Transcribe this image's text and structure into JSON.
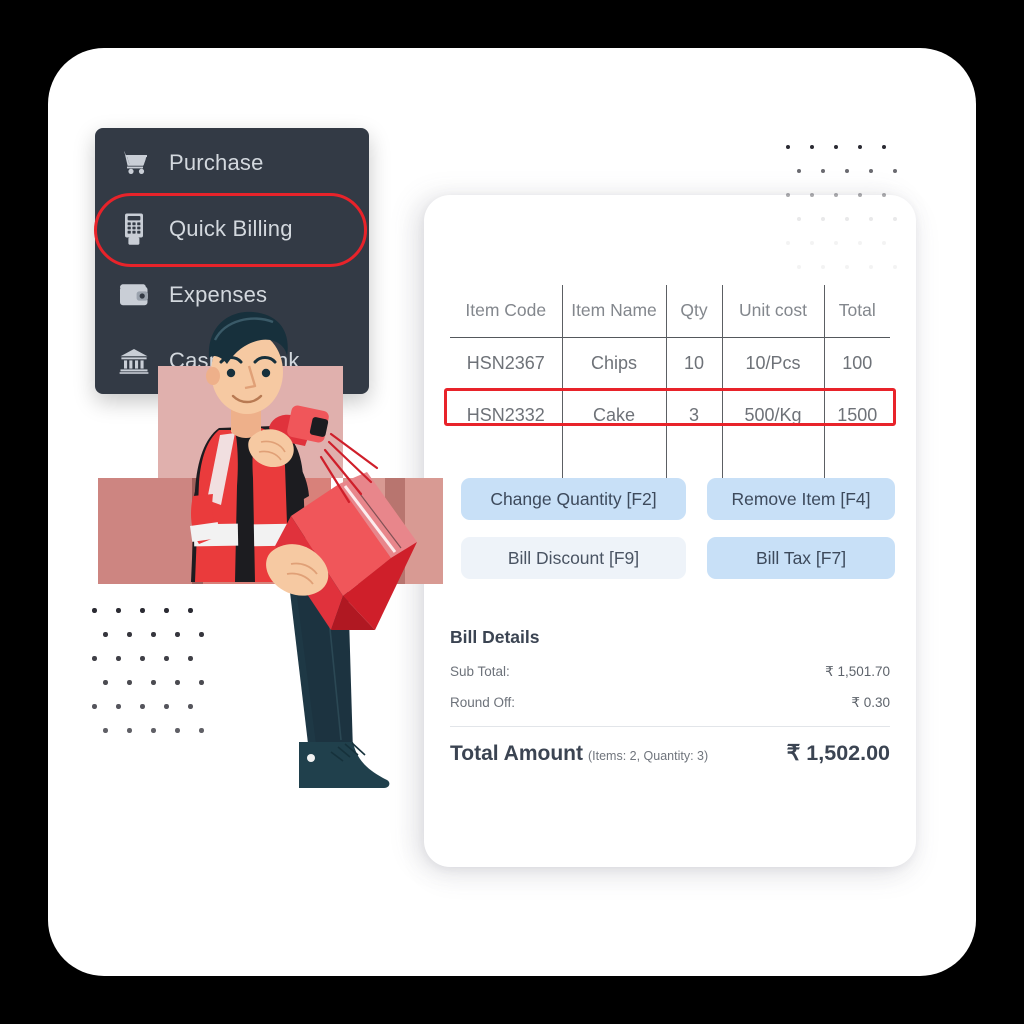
{
  "app": {
    "background_color": "#000000",
    "card_color": "#ffffff",
    "accent_red": "#e8232a",
    "sidebar_color": "#333a45",
    "button_blue": "#c8e0f7",
    "button_pale": "#eef3f9"
  },
  "sidebar": {
    "items": [
      {
        "label": "Purchase",
        "icon": "shopping-cart-icon",
        "active": false
      },
      {
        "label": "Quick Billing",
        "icon": "card-terminal-icon",
        "active": true
      },
      {
        "label": "Expenses",
        "icon": "wallet-icon",
        "active": false
      },
      {
        "label": "Cash & Bank",
        "icon": "bank-icon",
        "active": false
      }
    ]
  },
  "table": {
    "headers": [
      "Item Code",
      "Item Name",
      "Qty",
      "Unit cost",
      "Total"
    ],
    "rows": [
      {
        "item_code": "HSN2367",
        "item_name": "Chips",
        "qty": "10",
        "unit_cost": "10/Pcs",
        "total": "100",
        "highlighted": false
      },
      {
        "item_code": "HSN2332",
        "item_name": "Cake",
        "qty": "3",
        "unit_cost": "500/Kg",
        "total": "1500",
        "highlighted": true
      }
    ]
  },
  "actions": {
    "quantity": "Change Quantity [F2]",
    "remove": "Remove Item [F4]",
    "discount": "Bill Discount [F9]",
    "tax": "Bill Tax [F7]"
  },
  "bill_details": {
    "title": "Bill Details",
    "sub_total_label": "Sub Total:",
    "sub_total_value": "₹ 1,501.70",
    "round_off_label": "Round Off:",
    "round_off_value": "₹ 0.30",
    "total_label": "Total Amount",
    "total_meta": "(Items: 2, Quantity: 3)",
    "total_value": "₹ 1,502.00"
  },
  "illustration": {
    "name": "delivery-worker-scanning-package",
    "description": "Delivery worker in red and black vest holding a red package and a barcode scanner, standing beside stacked cardboard boxes"
  }
}
